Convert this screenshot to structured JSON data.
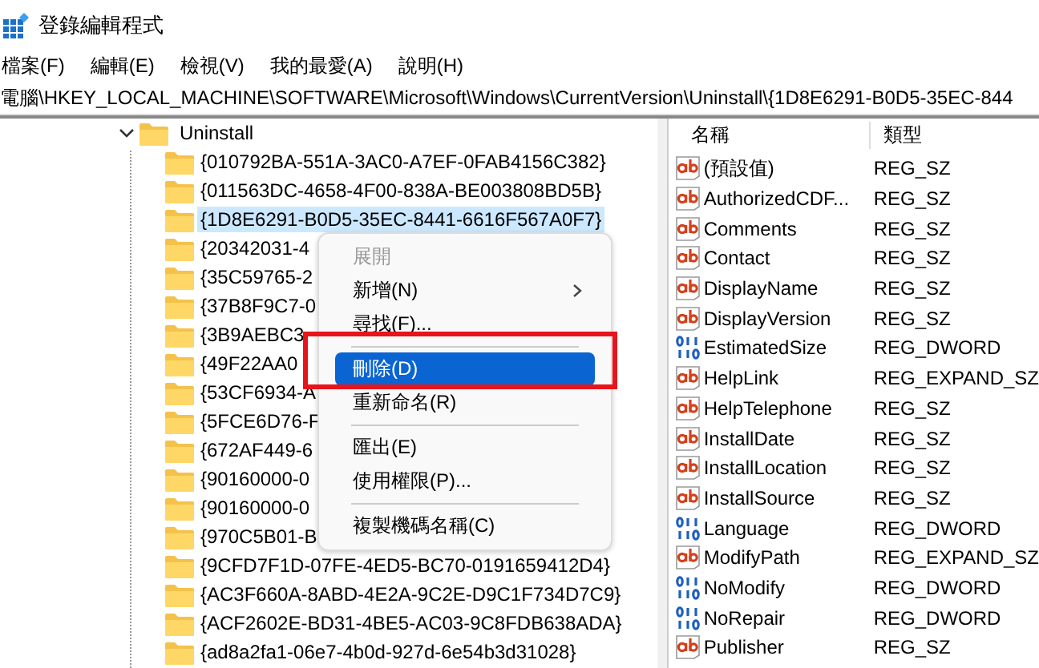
{
  "window": {
    "title": "登錄編輯程式"
  },
  "menu_bar": [
    "檔案(F)",
    "編輯(E)",
    "檢視(V)",
    "我的最愛(A)",
    "說明(H)"
  ],
  "address_bar": {
    "value": "電腦\\HKEY_LOCAL_MACHINE\\SOFTWARE\\Microsoft\\Windows\\CurrentVersion\\Uninstall\\{1D8E6291-B0D5-35EC-844"
  },
  "tree": {
    "label": "Uninstall",
    "expanded": true,
    "children": [
      {
        "label": "{010792BA-551A-3AC0-A7EF-0FAB4156C382}",
        "selected": false
      },
      {
        "label": "{011563DC-4658-4F00-838A-BE003808BD5B}",
        "selected": false
      },
      {
        "label": "{1D8E6291-B0D5-35EC-8441-6616F567A0F7}",
        "selected": true
      },
      {
        "label": "{20342031-4",
        "selected": false
      },
      {
        "label": "{35C59765-2",
        "selected": false
      },
      {
        "label": "{37B8F9C7-0",
        "selected": false
      },
      {
        "label": "{3B9AEBC3",
        "selected": false
      },
      {
        "label": "{49F22AA0",
        "selected": false
      },
      {
        "label": "{53CF6934-A",
        "selected": false
      },
      {
        "label": "{5FCE6D76-F",
        "selected": false
      },
      {
        "label": "{672AF449-6",
        "selected": false
      },
      {
        "label": "{90160000-0",
        "selected": false
      },
      {
        "label": "{90160000-0",
        "selected": false
      },
      {
        "label": "{970C5B01-B",
        "selected": false
      },
      {
        "label": "{9CFD7F1D-07FE-4ED5-BC70-0191659412D4}",
        "selected": false
      },
      {
        "label": "{AC3F660A-8ABD-4E2A-9C2E-D9C1F734D7C9}",
        "selected": false
      },
      {
        "label": "{ACF2602E-BD31-4BE5-AC03-9C8FDB638ADA}",
        "selected": false
      },
      {
        "label": "{ad8a2fa1-06e7-4b0d-927d-6e54b3d31028}",
        "selected": false
      }
    ]
  },
  "values": {
    "columns": [
      "名稱",
      "類型"
    ],
    "rows": [
      {
        "kind": "string",
        "name": "(預設值)",
        "type": "REG_SZ"
      },
      {
        "kind": "string",
        "name": "AuthorizedCDF...",
        "type": "REG_SZ"
      },
      {
        "kind": "string",
        "name": "Comments",
        "type": "REG_SZ"
      },
      {
        "kind": "string",
        "name": "Contact",
        "type": "REG_SZ"
      },
      {
        "kind": "string",
        "name": "DisplayName",
        "type": "REG_SZ"
      },
      {
        "kind": "string",
        "name": "DisplayVersion",
        "type": "REG_SZ"
      },
      {
        "kind": "dword",
        "name": "EstimatedSize",
        "type": "REG_DWORD"
      },
      {
        "kind": "string",
        "name": "HelpLink",
        "type": "REG_EXPAND_SZ"
      },
      {
        "kind": "string",
        "name": "HelpTelephone",
        "type": "REG_SZ"
      },
      {
        "kind": "string",
        "name": "InstallDate",
        "type": "REG_SZ"
      },
      {
        "kind": "string",
        "name": "InstallLocation",
        "type": "REG_SZ"
      },
      {
        "kind": "string",
        "name": "InstallSource",
        "type": "REG_SZ"
      },
      {
        "kind": "dword",
        "name": "Language",
        "type": "REG_DWORD"
      },
      {
        "kind": "string",
        "name": "ModifyPath",
        "type": "REG_EXPAND_SZ"
      },
      {
        "kind": "dword",
        "name": "NoModify",
        "type": "REG_DWORD"
      },
      {
        "kind": "dword",
        "name": "NoRepair",
        "type": "REG_DWORD"
      },
      {
        "kind": "string",
        "name": "Publisher",
        "type": "REG_SZ"
      }
    ]
  },
  "context_menu": {
    "items": [
      {
        "kind": "item",
        "label": "展開",
        "disabled": true,
        "selected": false
      },
      {
        "kind": "submenu",
        "label": "新增(N)",
        "disabled": false,
        "selected": false
      },
      {
        "kind": "item",
        "label": "尋找(F)...",
        "disabled": false,
        "selected": false
      },
      {
        "kind": "separator"
      },
      {
        "kind": "item",
        "label": "刪除(D)",
        "disabled": false,
        "selected": true
      },
      {
        "kind": "item",
        "label": "重新命名(R)",
        "disabled": false,
        "selected": false
      },
      {
        "kind": "separator"
      },
      {
        "kind": "item",
        "label": "匯出(E)",
        "disabled": false,
        "selected": false
      },
      {
        "kind": "item",
        "label": "使用權限(P)...",
        "disabled": false,
        "selected": false
      },
      {
        "kind": "separator"
      },
      {
        "kind": "item",
        "label": "複製機碼名稱(C)",
        "disabled": false,
        "selected": false
      }
    ]
  }
}
